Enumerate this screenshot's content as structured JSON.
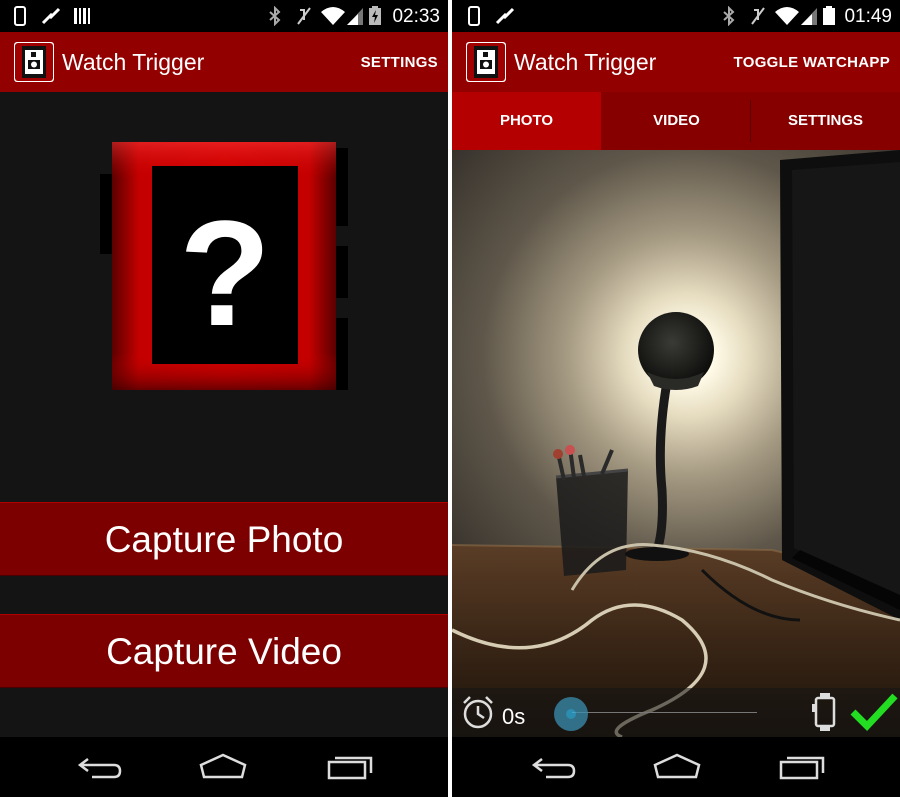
{
  "screens": [
    {
      "status_bar": {
        "time": "02:33"
      },
      "action_bar": {
        "title": "Watch Trigger",
        "action": "SETTINGS"
      },
      "watch_display": {
        "glyph": "?"
      },
      "buttons": {
        "capture_photo": "Capture Photo",
        "capture_video": "Capture Video"
      }
    },
    {
      "status_bar": {
        "time": "01:49"
      },
      "action_bar": {
        "title": "Watch Trigger",
        "action": "TOGGLE WATCHAPP"
      },
      "tabs": [
        {
          "label": "PHOTO",
          "active": true
        },
        {
          "label": "VIDEO",
          "active": false
        },
        {
          "label": "SETTINGS",
          "active": false
        }
      ],
      "controls": {
        "timer_value": "0s",
        "confirm_icon": "checkmark-icon",
        "alarm_icon": "alarm-clock-icon",
        "watch_icon": "watch-icon"
      }
    }
  ],
  "colors": {
    "action_bar": "#930000",
    "active_tab": "#b40000",
    "button": "#7d0000",
    "confirm": "#22dd22",
    "slider_thumb": "#33b5e5"
  }
}
